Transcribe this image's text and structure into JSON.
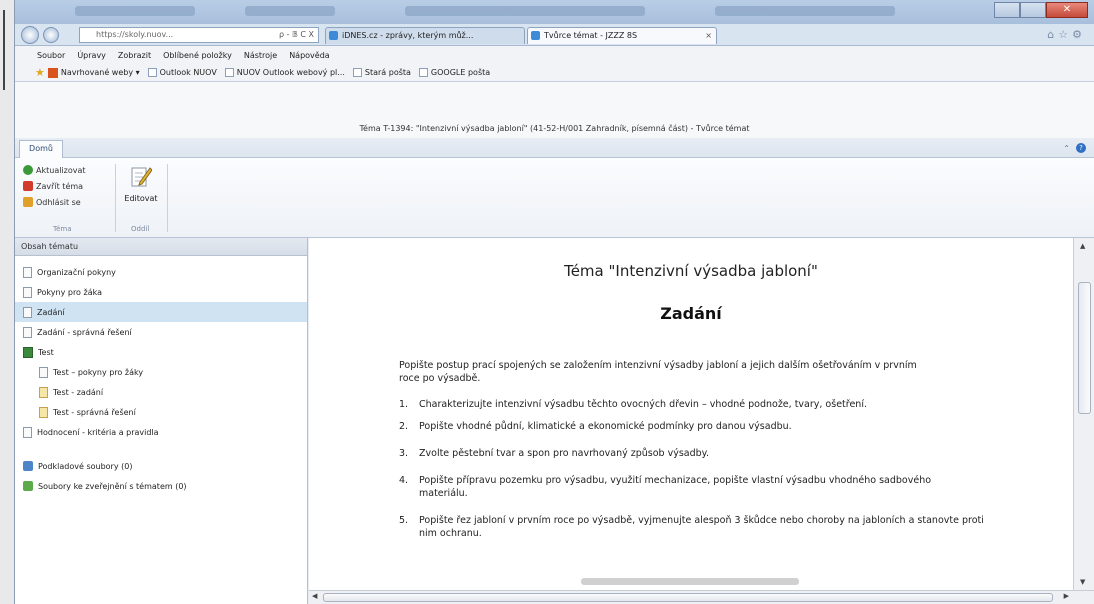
{
  "browser": {
    "url": "https://skoly.nuov...",
    "url_controls": "ρ - 𝔹 C X",
    "tabs": [
      {
        "label": "iDNES.cz - zprávy, kterým můž...",
        "active": false
      },
      {
        "label": "Tvůrce témat - JZZZ 8S",
        "active": true,
        "close": "×"
      }
    ],
    "menu": [
      "Soubor",
      "Úpravy",
      "Zobrazit",
      "Oblíbené položky",
      "Nástroje",
      "Nápověda"
    ],
    "favorites": [
      {
        "label": "Navrhované weby ▾",
        "icon": "suggested-sites-icon"
      },
      {
        "label": "Outlook NUOV",
        "icon": "page-icon"
      },
      {
        "label": "NUOV Outlook webový pl...",
        "icon": "page-icon"
      },
      {
        "label": "Stará pošta",
        "icon": "page-icon"
      },
      {
        "label": "GOOGLE pošta",
        "icon": "page-icon"
      }
    ]
  },
  "app": {
    "title": "Téma T-1394: \"Intenzivní výsadba jabloní\" (41-52-H/001 Zahradník, písemná část) - Tvůrce témat",
    "ribbon_tab": "Domů",
    "ribbon": {
      "tema_group": {
        "label": "Téma",
        "buttons": [
          {
            "label": "Aktualizovat",
            "icon": "refresh-icon",
            "color": "#3a9a3a"
          },
          {
            "label": "Zavřít téma",
            "icon": "close-topic-icon",
            "color": "#d23a2a"
          },
          {
            "label": "Odhlásit se",
            "icon": "logout-icon",
            "color": "#e0a02a"
          }
        ]
      },
      "oddil_group": {
        "label": "Oddíl",
        "edit_label": "Editovat"
      }
    },
    "help_icon": "?"
  },
  "sidebar": {
    "header": "Obsah tématu",
    "items": [
      {
        "label": "Organizační pokyny",
        "level": 0,
        "icon": "doc",
        "selected": false
      },
      {
        "label": "Pokyny pro žáka",
        "level": 0,
        "icon": "doc",
        "selected": false
      },
      {
        "label": "Zadání",
        "level": 0,
        "icon": "doc",
        "selected": true
      },
      {
        "label": "Zadání - správná řešení",
        "level": 0,
        "icon": "doc",
        "selected": false
      },
      {
        "label": "Test",
        "level": 0,
        "icon": "test",
        "selected": false
      },
      {
        "label": "Test – pokyny pro žáky",
        "level": 1,
        "icon": "doc",
        "selected": false
      },
      {
        "label": "Test - zadání",
        "level": 1,
        "icon": "doc-yellow",
        "selected": false
      },
      {
        "label": "Test - správná řešení",
        "level": 1,
        "icon": "doc-yellow",
        "selected": false
      },
      {
        "label": "Hodnocení - kritéria a pravidla",
        "level": 0,
        "icon": "doc",
        "selected": false
      }
    ],
    "attachments": [
      {
        "label": "Podkladové soubory (0)",
        "icon": "attachment"
      },
      {
        "label": "Soubory ke zveřejnění s tématem (0)",
        "icon": "attachment-green"
      }
    ]
  },
  "document": {
    "title": "Téma \"Intenzivní výsadba jabloní\"",
    "heading": "Zadání",
    "intro": "Popište postup prací spojených se založením intenzivní výsadby jabloní a jejich dalším ošetřováním v prvním roce po výsadbě.",
    "items": [
      {
        "num": "1.",
        "text": "Charakterizujte intenzivní výsadbu těchto ovocných dřevin – vhodné podnože, tvary, ošetření."
      },
      {
        "num": "2.",
        "text": "Popište vhodné půdní, klimatické a ekonomické podmínky pro danou výsadbu."
      },
      {
        "num": "3.",
        "text": "Zvolte pěstební tvar a spon pro navrhovaný způsob výsadby."
      },
      {
        "num": "4.",
        "text": "Popište přípravu pozemku pro výsadbu, využití mechanizace, popište vlastní výsadbu vhodného sadbového materiálu."
      },
      {
        "num": "5.",
        "text": "Popište řez jabloní v prvním roce po výsadbě, vyjmenujte alespoň 3 škůdce nebo choroby na jabloních a stanovte proti nim ochranu."
      }
    ]
  }
}
